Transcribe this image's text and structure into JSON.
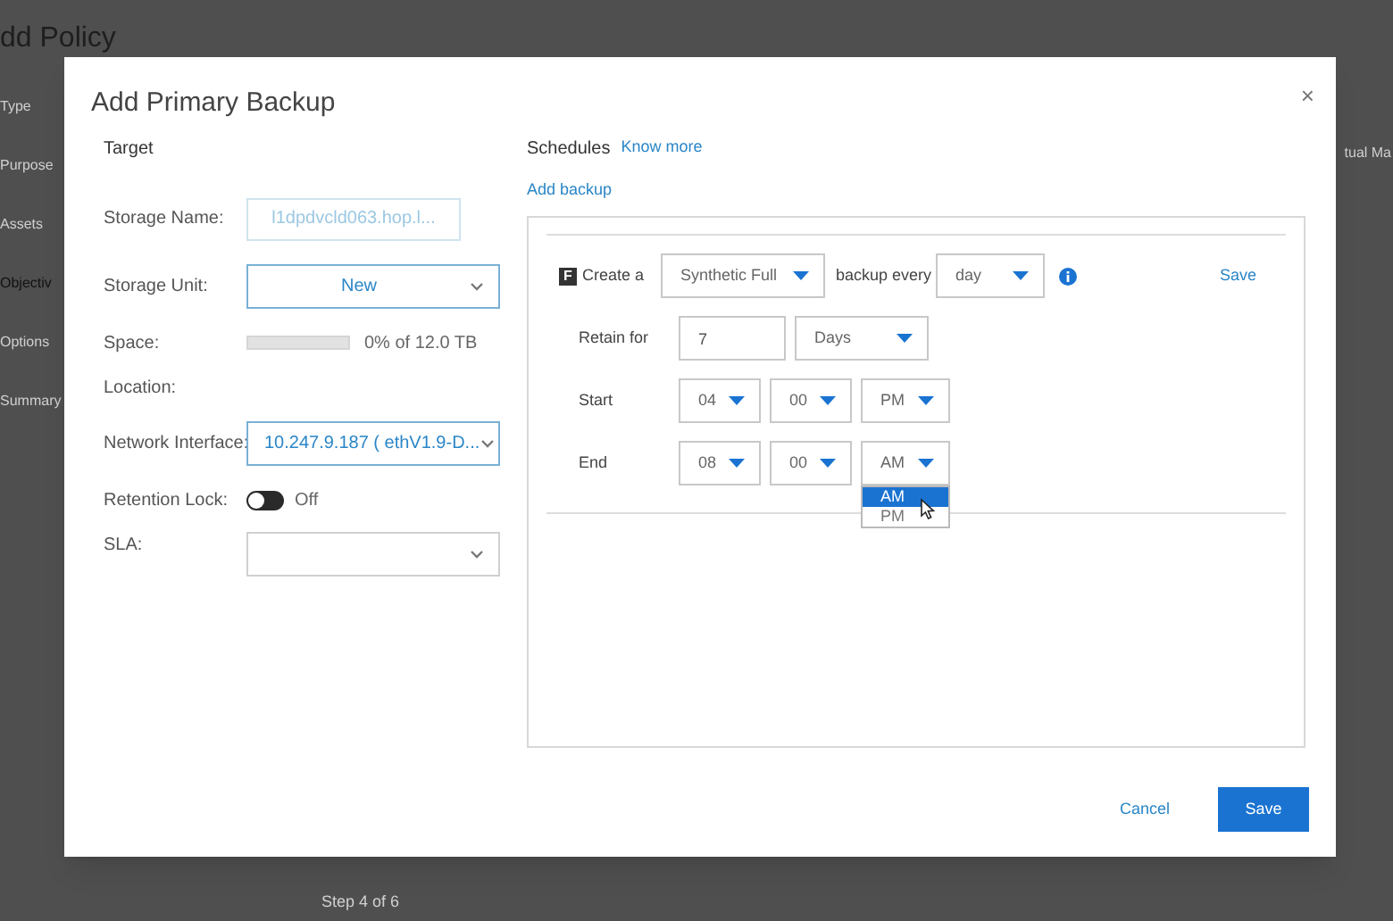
{
  "background": {
    "title": "dd Policy",
    "steps": [
      "Type",
      "Purpose",
      "Assets",
      "Objectiv",
      "Options",
      "Summary"
    ],
    "column_text": "tual Ma",
    "footer": "Step 4 of 6"
  },
  "dialog": {
    "title": "Add Primary Backup",
    "close": "×",
    "target": {
      "heading": "Target",
      "fields": [
        {
          "kind": "input",
          "label": "Storage Name:",
          "value": "l1dpdvcld063.hop.l...",
          "disabled": true
        },
        {
          "kind": "select",
          "label": "Storage Unit:",
          "value": "New"
        },
        {
          "kind": "meter",
          "label": "Space:",
          "level": 0,
          "reading": "0% of 12.0 TB"
        },
        {
          "kind": "text",
          "label": "Location:"
        },
        {
          "kind": "select",
          "label": "Network Interface:",
          "value": "10.247.9.187 ( ethV1.9-D..."
        },
        {
          "kind": "toggle",
          "label": "Retention Lock:",
          "on": false,
          "state_text": "Off"
        },
        {
          "kind": "select",
          "label": "SLA:"
        }
      ]
    },
    "schedules": {
      "heading": "Schedules",
      "know_more": "Know more",
      "add_backup": "Add backup",
      "type_badge": "F",
      "create_label": "Create a",
      "backup_type": "Synthetic Full",
      "every_label": "backup every",
      "interval": "day",
      "save": "Save",
      "retain_label": "Retain for",
      "retain_value": "7",
      "retain_unit": "Days",
      "times": [
        {
          "label": "Start",
          "hour": "04",
          "minute": "00",
          "ampm": "PM"
        },
        {
          "label": "End",
          "hour": "08",
          "minute": "00",
          "ampm": "AM",
          "open": true,
          "options": [
            {
              "label": "AM",
              "selected": true
            },
            {
              "label": "PM",
              "selected": false
            }
          ]
        }
      ]
    },
    "buttons": [
      {
        "label": "Cancel",
        "kind": "secondary"
      },
      {
        "label": "Save",
        "kind": "primary"
      }
    ]
  }
}
